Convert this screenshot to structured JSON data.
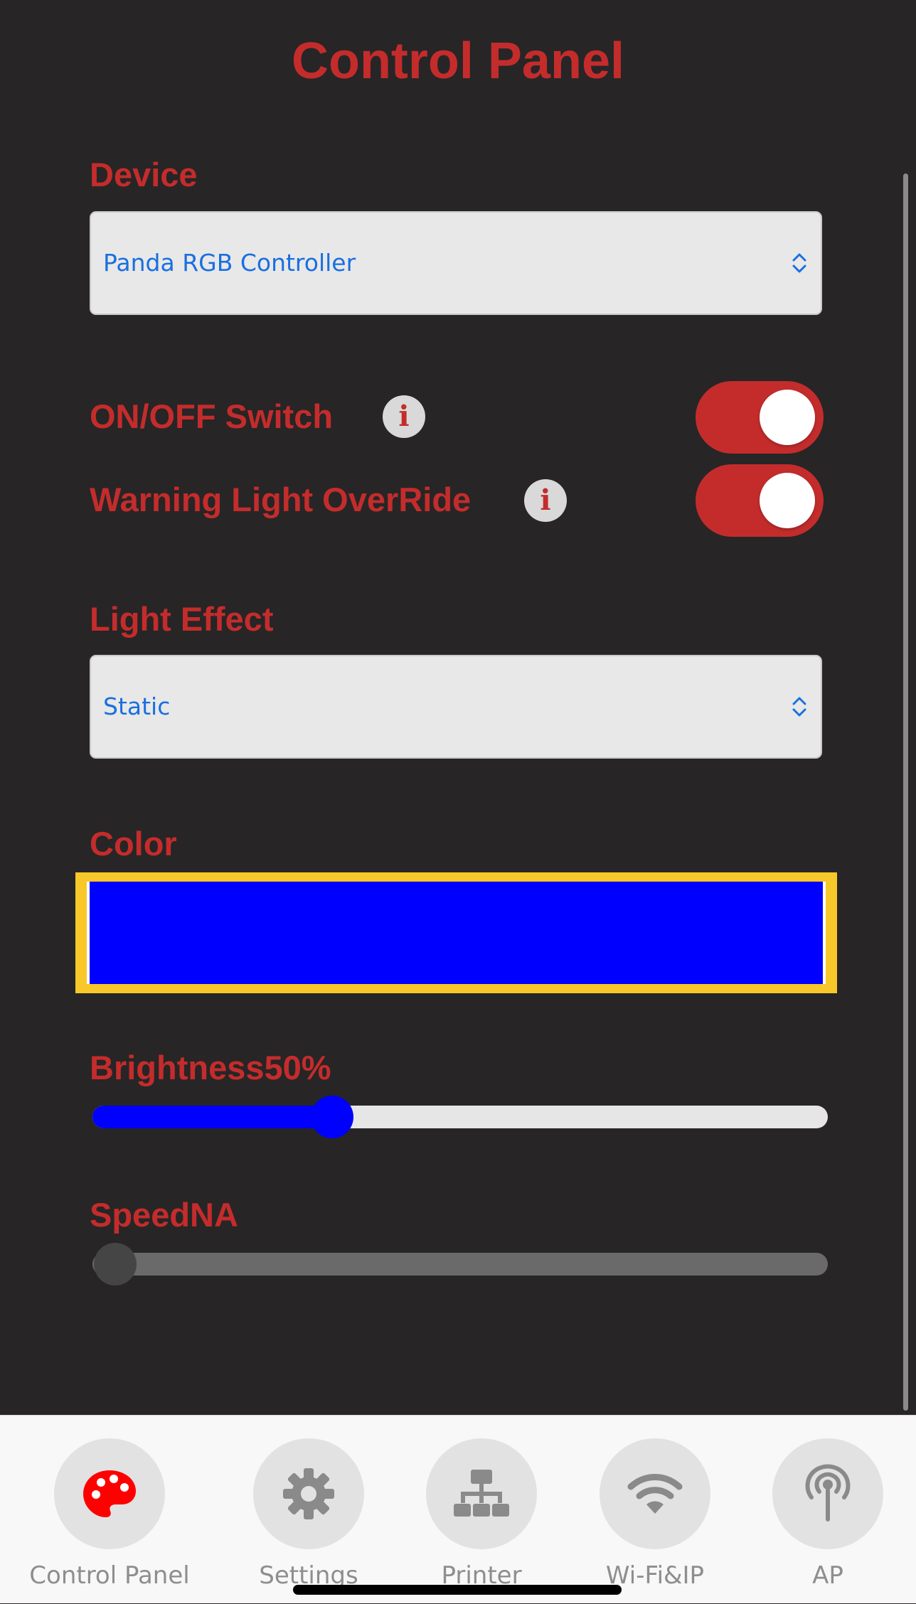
{
  "header": {
    "title": "Control Panel"
  },
  "device": {
    "label": "Device",
    "selected": "Panda RGB Controller"
  },
  "toggles": [
    {
      "label": "ON/OFF Switch",
      "on": true,
      "info_icon": "i"
    },
    {
      "label": "Warning Light OverRide",
      "on": true,
      "info_icon": "i"
    }
  ],
  "effect": {
    "label": "Light Effect",
    "selected": "Static"
  },
  "color": {
    "label": "Color",
    "value": "#0000ff",
    "highlight": "#f8c72a"
  },
  "brightness": {
    "label": "Brightness50%",
    "value": 50,
    "fill_color": "#0000ff"
  },
  "speed": {
    "label": "SpeedNA",
    "value": 0
  },
  "tabs": [
    {
      "label": "Control Panel",
      "icon": "palette-icon",
      "active": true
    },
    {
      "label": "Settings",
      "icon": "gear-icon",
      "active": false
    },
    {
      "label": "Printer",
      "icon": "network-icon",
      "active": false
    },
    {
      "label": "Wi-Fi&IP",
      "icon": "wifi-icon",
      "active": false
    },
    {
      "label": "AP",
      "icon": "antenna-icon",
      "active": false
    }
  ],
  "colors": {
    "accent": "#c42c2c",
    "background": "#272526",
    "select_text": "#1a6fe0",
    "active_tab_icon": "#ff0000",
    "inactive_tab_icon": "#8a8a8a"
  }
}
